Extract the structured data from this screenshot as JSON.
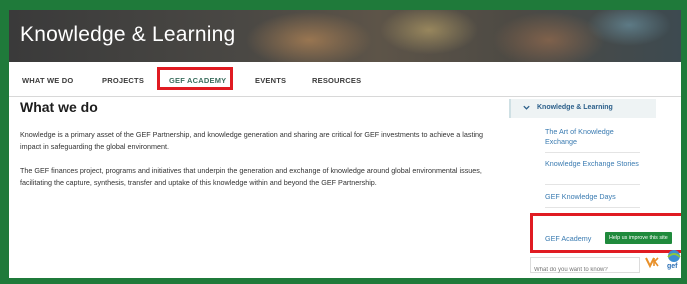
{
  "hero": {
    "title": "Knowledge & Learning"
  },
  "tabs": [
    {
      "label": "WHAT WE DO"
    },
    {
      "label": "PROJECTS"
    },
    {
      "label": "GEF ACADEMY"
    },
    {
      "label": "EVENTS"
    },
    {
      "label": "RESOURCES"
    }
  ],
  "main": {
    "heading": "What we do",
    "paragraphs": [
      "Knowledge is a primary asset of the GEF Partnership, and knowledge generation and sharing are critical for GEF investments to achieve a lasting impact in safeguarding the global environment.",
      "The GEF finances project, programs and initiatives that underpin the generation and exchange of knowledge around global environmental issues, facilitating the capture, synthesis, transfer and uptake of this knowledge within and beyond the GEF Partnership."
    ]
  },
  "sidebar": {
    "heading": "Knowledge & Learning",
    "items": [
      {
        "label": "The Art of Knowledge Exchange"
      },
      {
        "label": "Knowledge Exchange Stories"
      },
      {
        "label": "GEF Knowledge Days"
      },
      {
        "label": "GEF Academy"
      }
    ]
  },
  "help_button": {
    "label": "Help us improve this site"
  },
  "search": {
    "placeholder": "What do you want to know?"
  },
  "logo": {
    "label": "gef"
  },
  "colors": {
    "frame": "#1f7a3a",
    "highlight": "#e01b22",
    "link": "#3a7bb1",
    "help_button": "#1f8a3c"
  }
}
